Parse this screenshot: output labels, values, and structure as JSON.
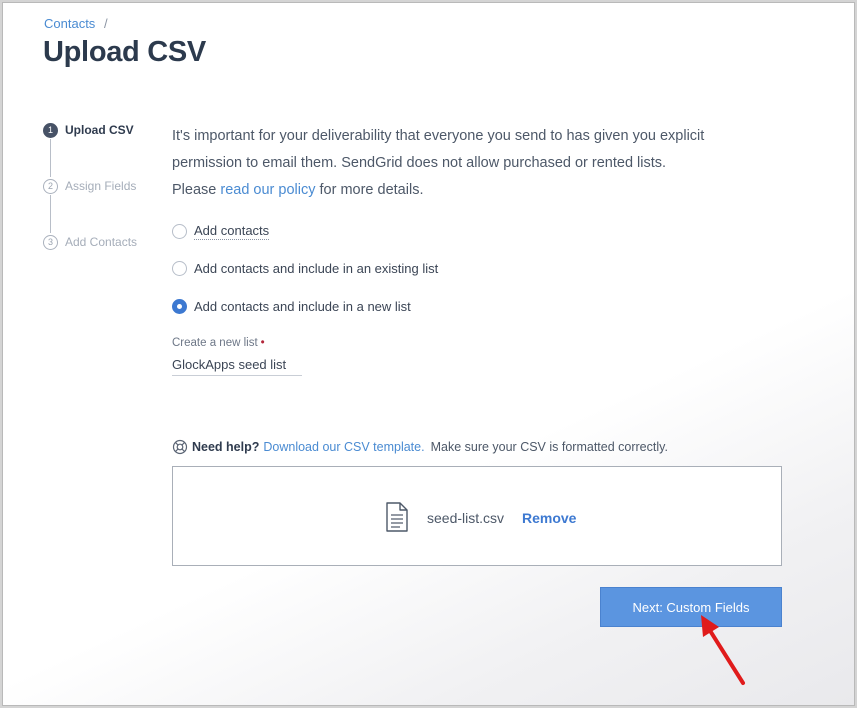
{
  "breadcrumb": {
    "parent": "Contacts",
    "separator": "/"
  },
  "page": {
    "title": "Upload CSV"
  },
  "stepper": {
    "steps": [
      {
        "number": "1",
        "label": "Upload CSV",
        "state": "active"
      },
      {
        "number": "2",
        "label": "Assign Fields",
        "state": "pending"
      },
      {
        "number": "3",
        "label": "Add Contacts",
        "state": "pending"
      }
    ]
  },
  "intro": {
    "line1": "It's important for your deliverability that everyone you send to has given you explicit",
    "line2": "permission to email them. SendGrid does not allow purchased or rented lists.",
    "line3_prefix": "Please ",
    "policy_link": "read our policy",
    "line3_suffix": " for more details."
  },
  "options": [
    {
      "label": "Add contacts",
      "selected": false
    },
    {
      "label": "Add contacts and include in an existing list",
      "selected": false
    },
    {
      "label": "Add contacts and include in a new list",
      "selected": true
    }
  ],
  "new_list": {
    "label": "Create a new list",
    "required_mark": "•",
    "value": "GlockApps seed list"
  },
  "help": {
    "icon": "lifebuoy-icon",
    "title": "Need help?",
    "link": "Download our CSV template.",
    "note": "Make sure your CSV is formatted correctly."
  },
  "upload": {
    "file_icon": "document-icon",
    "file_name": "seed-list.csv",
    "remove_label": "Remove"
  },
  "actions": {
    "next_label": "Next: Custom Fields"
  },
  "colors": {
    "accent": "#3d79d1",
    "button": "#5b95e0",
    "title": "#2c3a4d",
    "annotation_arrow": "#e01b1b"
  }
}
